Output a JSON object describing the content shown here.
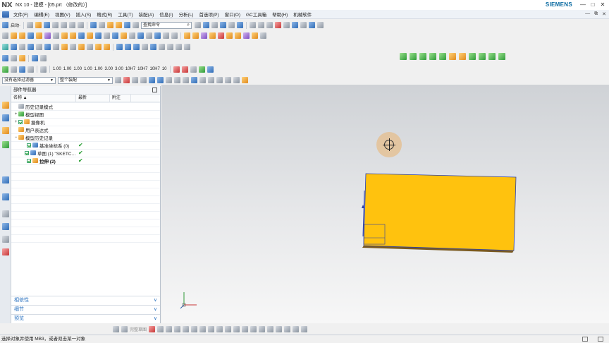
{
  "window": {
    "logo": "NX",
    "title": "NX 10 - 建模 - [05.prt （修改的）]",
    "brand": "SIEMENS",
    "controls": [
      "—",
      "□",
      "✕"
    ]
  },
  "menubar": {
    "items": [
      "文件(F)",
      "编辑(E)",
      "视图(V)",
      "插入(S)",
      "格式(R)",
      "工具(T)",
      "装配(A)",
      "信息(I)",
      "分析(L)",
      "首选项(P)",
      "窗口(O)",
      "GC工具箱",
      "帮助(H)",
      "机械软件"
    ],
    "right_controls": [
      "—",
      "⧉",
      "✕"
    ]
  },
  "toolbar": {
    "start_label": "启动·",
    "search_placeholder": "查找命令",
    "filter_value": "没有选择过滤器",
    "assembly_value": "整个装配",
    "dims": [
      "1.00",
      "1.00",
      "1.00",
      "1.00",
      "1.00",
      "3.00",
      "3.00",
      "10H7",
      "10H7",
      "10H7",
      "10"
    ]
  },
  "navigator": {
    "title": "部件导航器",
    "columns": [
      "名称",
      "最新",
      "附注"
    ],
    "rows": [
      {
        "label": "历史记录模式",
        "latest": "",
        "icon": "clock-icon",
        "indent": 1,
        "expander": "",
        "check": false,
        "bold": false
      },
      {
        "label": "模型视图",
        "latest": "",
        "icon": "model-views-icon",
        "indent": 1,
        "expander": "+",
        "check": false,
        "bold": false
      },
      {
        "label": "摄像机",
        "latest": "",
        "icon": "camera-icon",
        "indent": 1,
        "expander": "+",
        "check": true,
        "bold": false
      },
      {
        "label": "用户表达式",
        "latest": "",
        "icon": "folder-icon",
        "indent": 1,
        "expander": "",
        "check": false,
        "bold": false
      },
      {
        "label": "模型历史记录",
        "latest": "",
        "icon": "folder-open-icon",
        "indent": 1,
        "expander": "−",
        "check": false,
        "bold": false
      },
      {
        "label": "基准坐标系 (0)",
        "latest": "✔",
        "icon": "datum-csys-icon",
        "indent": 2,
        "expander": "",
        "check": true,
        "bold": false
      },
      {
        "label": "草图 (1) \"SKETC…",
        "latest": "✔",
        "icon": "sketch-icon",
        "indent": 2,
        "expander": "",
        "check": true,
        "bold": false
      },
      {
        "label": "拉伸 (2)",
        "latest": "✔",
        "icon": "extrude-icon",
        "indent": 2,
        "expander": "",
        "check": true,
        "bold": true
      }
    ],
    "panels": [
      "相依性",
      "细节",
      "预览"
    ]
  },
  "status": {
    "message": "选择对象并使用 MB3，或者双击某一对象"
  },
  "bottom_toolbar": {
    "label": "完整草图"
  },
  "colors": {
    "block": "#ffc20e",
    "block_bottom": "#7a5a20",
    "edge": "#2b3fa8",
    "accent": "#2b72c0"
  }
}
